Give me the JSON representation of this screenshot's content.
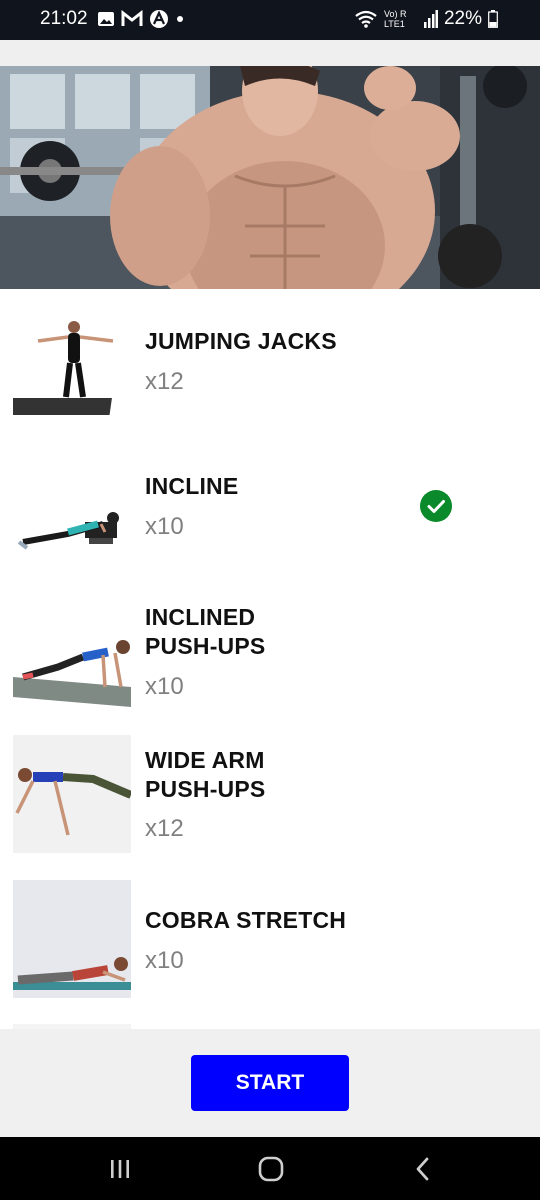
{
  "status": {
    "time": "21:02",
    "battery": "22%",
    "network": "Vo) R LTE1"
  },
  "exercises": [
    {
      "name": "JUMPING JACKS",
      "reps": "x12",
      "completed": false
    },
    {
      "name": "INCLINE",
      "reps": "x10",
      "completed": true
    },
    {
      "name": "INCLINED PUSH-UPS",
      "reps": "x10",
      "completed": false
    },
    {
      "name": "WIDE ARM PUSH-UPS",
      "reps": "x12",
      "completed": false
    },
    {
      "name": "COBRA STRETCH",
      "reps": "x10",
      "completed": false
    }
  ],
  "start_label": "START",
  "colors": {
    "accent": "#0000ff",
    "check": "#0a8a2a",
    "reps": "#808080"
  }
}
